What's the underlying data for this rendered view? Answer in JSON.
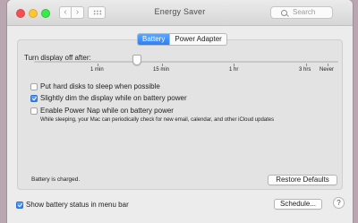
{
  "window": {
    "title": "Energy Saver"
  },
  "toolbar": {
    "back_glyph": "‹",
    "forward_glyph": "›",
    "search_placeholder": "Search"
  },
  "tabs": [
    {
      "label": "Battery",
      "selected": true
    },
    {
      "label": "Power Adapter",
      "selected": false
    }
  ],
  "slider": {
    "label": "Turn display off after:",
    "ticks": [
      "1 min",
      "15 min",
      "1 hr",
      "3 hrs",
      "Never"
    ],
    "value_label": "between 1 min and 15 min"
  },
  "options": [
    {
      "label": "Put hard disks to sleep when possible",
      "checked": false
    },
    {
      "label": "Slightly dim the display while on battery power",
      "checked": true
    },
    {
      "label": "Enable Power Nap while on battery power",
      "checked": false
    }
  ],
  "power_nap_note": "While sleeping, your Mac can periodically check for new email, calendar, and other iCloud updates",
  "battery_status": "Battery is charged.",
  "restore_defaults_label": "Restore Defaults",
  "show_battery_status": {
    "label": "Show battery status in menu bar",
    "checked": true
  },
  "schedule_label": "Schedule...",
  "help_label": "?"
}
